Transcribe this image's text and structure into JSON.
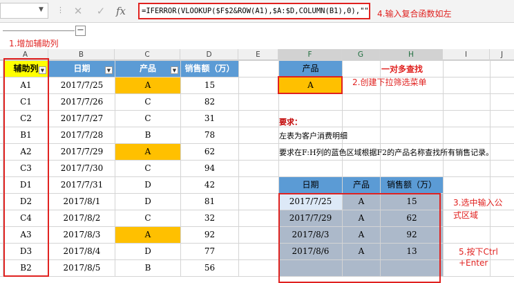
{
  "formula_bar": {
    "cancel_icon": "✕",
    "enter_icon": "✓",
    "fx_label": "fx",
    "formula": "=IFERROR(VLOOKUP($F$2&ROW(A1),$A:$D,COLUMN(B1),0),\"\")"
  },
  "columns": [
    "A",
    "B",
    "C",
    "D",
    "E",
    "F",
    "G",
    "H",
    "I",
    "J"
  ],
  "annotations": {
    "step1": "1.增加辅助列",
    "step2": "2.创建下拉筛选菜单",
    "step3_line1": "3.选中输入公",
    "step3_line2": "式区域",
    "step4": "4.输入复合函数如左",
    "step5_line1": "5.按下Ctrl",
    "step5_line2": "+Enter"
  },
  "left_table": {
    "headers": [
      "辅助列",
      "日期",
      "产品",
      "销售额（万）"
    ],
    "rows": [
      {
        "key": "A1",
        "date": "2017/7/25",
        "product": "A",
        "sales": "15"
      },
      {
        "key": "C1",
        "date": "2017/7/26",
        "product": "C",
        "sales": "82"
      },
      {
        "key": "C2",
        "date": "2017/7/27",
        "product": "C",
        "sales": "31"
      },
      {
        "key": "B1",
        "date": "2017/7/28",
        "product": "B",
        "sales": "78"
      },
      {
        "key": "A2",
        "date": "2017/7/29",
        "product": "A",
        "sales": "62"
      },
      {
        "key": "C3",
        "date": "2017/7/30",
        "product": "C",
        "sales": "94"
      },
      {
        "key": "D1",
        "date": "2017/7/31",
        "product": "D",
        "sales": "42"
      },
      {
        "key": "D2",
        "date": "2017/8/1",
        "product": "D",
        "sales": "81"
      },
      {
        "key": "C4",
        "date": "2017/8/2",
        "product": "C",
        "sales": "32"
      },
      {
        "key": "A3",
        "date": "2017/8/3",
        "product": "A",
        "sales": "92"
      },
      {
        "key": "D3",
        "date": "2017/8/4",
        "product": "D",
        "sales": "77"
      },
      {
        "key": "B2",
        "date": "2017/8/5",
        "product": "B",
        "sales": "56"
      }
    ]
  },
  "selector": {
    "header": "产品",
    "value": "A",
    "title": "一对多查找"
  },
  "requirements": {
    "title": "要求：",
    "line1": "左表为客户消费明细",
    "line2": "要求在F:H列的蓝色区域根据F2的产品名称查找所有销售记录。"
  },
  "result_table": {
    "headers": [
      "日期",
      "产品",
      "销售额（万）"
    ],
    "rows": [
      {
        "date": "2017/7/25",
        "product": "A",
        "sales": "15"
      },
      {
        "date": "2017/7/29",
        "product": "A",
        "sales": "62"
      },
      {
        "date": "2017/8/3",
        "product": "A",
        "sales": "92"
      },
      {
        "date": "2017/8/6",
        "product": "A",
        "sales": "13"
      },
      {
        "date": "",
        "product": "",
        "sales": ""
      }
    ]
  },
  "colors": {
    "header_blue": "#5b9bd5",
    "yellow": "#ffff00",
    "orange": "#ffc000",
    "result_fill": "#acb9ca",
    "active_cell": "#dde9f7",
    "red": "#e0211f"
  }
}
